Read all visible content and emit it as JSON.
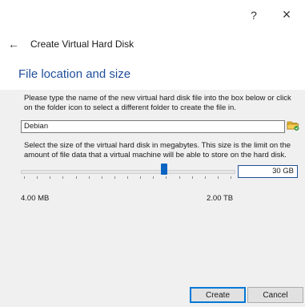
{
  "window": {
    "help_label": "?",
    "close_label": "×"
  },
  "nav": {
    "back_label": "←",
    "wizard_title": "Create Virtual Hard Disk"
  },
  "page": {
    "title": "File location and size",
    "location_instruction": "Please type the name of the new virtual hard disk file into the box below or click on the folder icon to select a different folder to create the file in.",
    "file_name": "Debian",
    "size_instruction": "Select the size of the virtual hard disk in megabytes. This size is the limit on the amount of file data that a virtual machine will be able to store on the hard disk."
  },
  "size": {
    "value_text": "30 GB",
    "min_label": "4.00 MB",
    "max_label": "2.00 TB",
    "slider_fraction": 0.68
  },
  "footer": {
    "create_label": "Create",
    "cancel_label": "Cancel"
  },
  "icons": {
    "folder": "folder-icon"
  },
  "colors": {
    "title": "#1f4e9b",
    "slider_handle": "#0a64c2",
    "panel_bg": "#f0f0f0"
  }
}
